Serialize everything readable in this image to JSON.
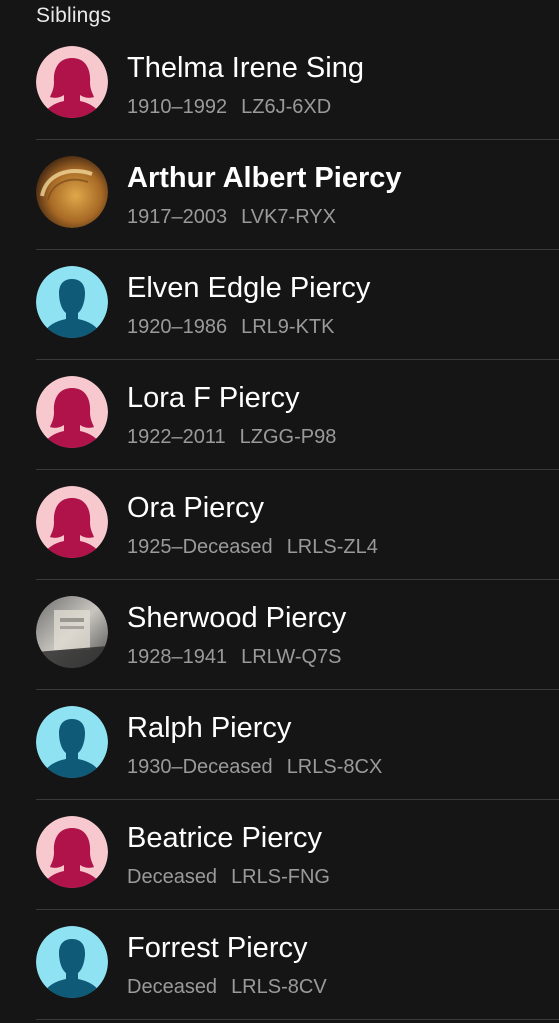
{
  "section_title": "Siblings",
  "colors": {
    "female_bg": "#f7c9ce",
    "female_fg": "#b0124a",
    "male_bg": "#8fe2f2",
    "male_fg": "#0f5a77"
  },
  "siblings": [
    {
      "name": "Thelma Irene Sing",
      "dates": "1910–1992",
      "pid": "LZ6J-6XD",
      "avatar": "female-silhouette-icon",
      "bold": false
    },
    {
      "name": "Arthur Albert Piercy",
      "dates": "1917–2003",
      "pid": "LVK7-RYX",
      "avatar": "photo-gold",
      "bold": true
    },
    {
      "name": "Elven Edgle Piercy",
      "dates": "1920–1986",
      "pid": "LRL9-KTK",
      "avatar": "male-silhouette-icon",
      "bold": false
    },
    {
      "name": "Lora F Piercy",
      "dates": "1922–2011",
      "pid": "LZGG-P98",
      "avatar": "female-silhouette-icon",
      "bold": false
    },
    {
      "name": "Ora Piercy",
      "dates": "1925–Deceased",
      "pid": "LRLS-ZL4",
      "avatar": "female-silhouette-icon",
      "bold": false
    },
    {
      "name": "Sherwood Piercy",
      "dates": "1928–1941",
      "pid": "LRLW-Q7S",
      "avatar": "photo-gray",
      "bold": false
    },
    {
      "name": "Ralph Piercy",
      "dates": "1930–Deceased",
      "pid": "LRLS-8CX",
      "avatar": "male-silhouette-icon",
      "bold": false
    },
    {
      "name": "Beatrice Piercy",
      "dates": "Deceased",
      "pid": "LRLS-FNG",
      "avatar": "female-silhouette-icon",
      "bold": false
    },
    {
      "name": "Forrest Piercy",
      "dates": "Deceased",
      "pid": "LRLS-8CV",
      "avatar": "male-silhouette-icon",
      "bold": false
    }
  ]
}
